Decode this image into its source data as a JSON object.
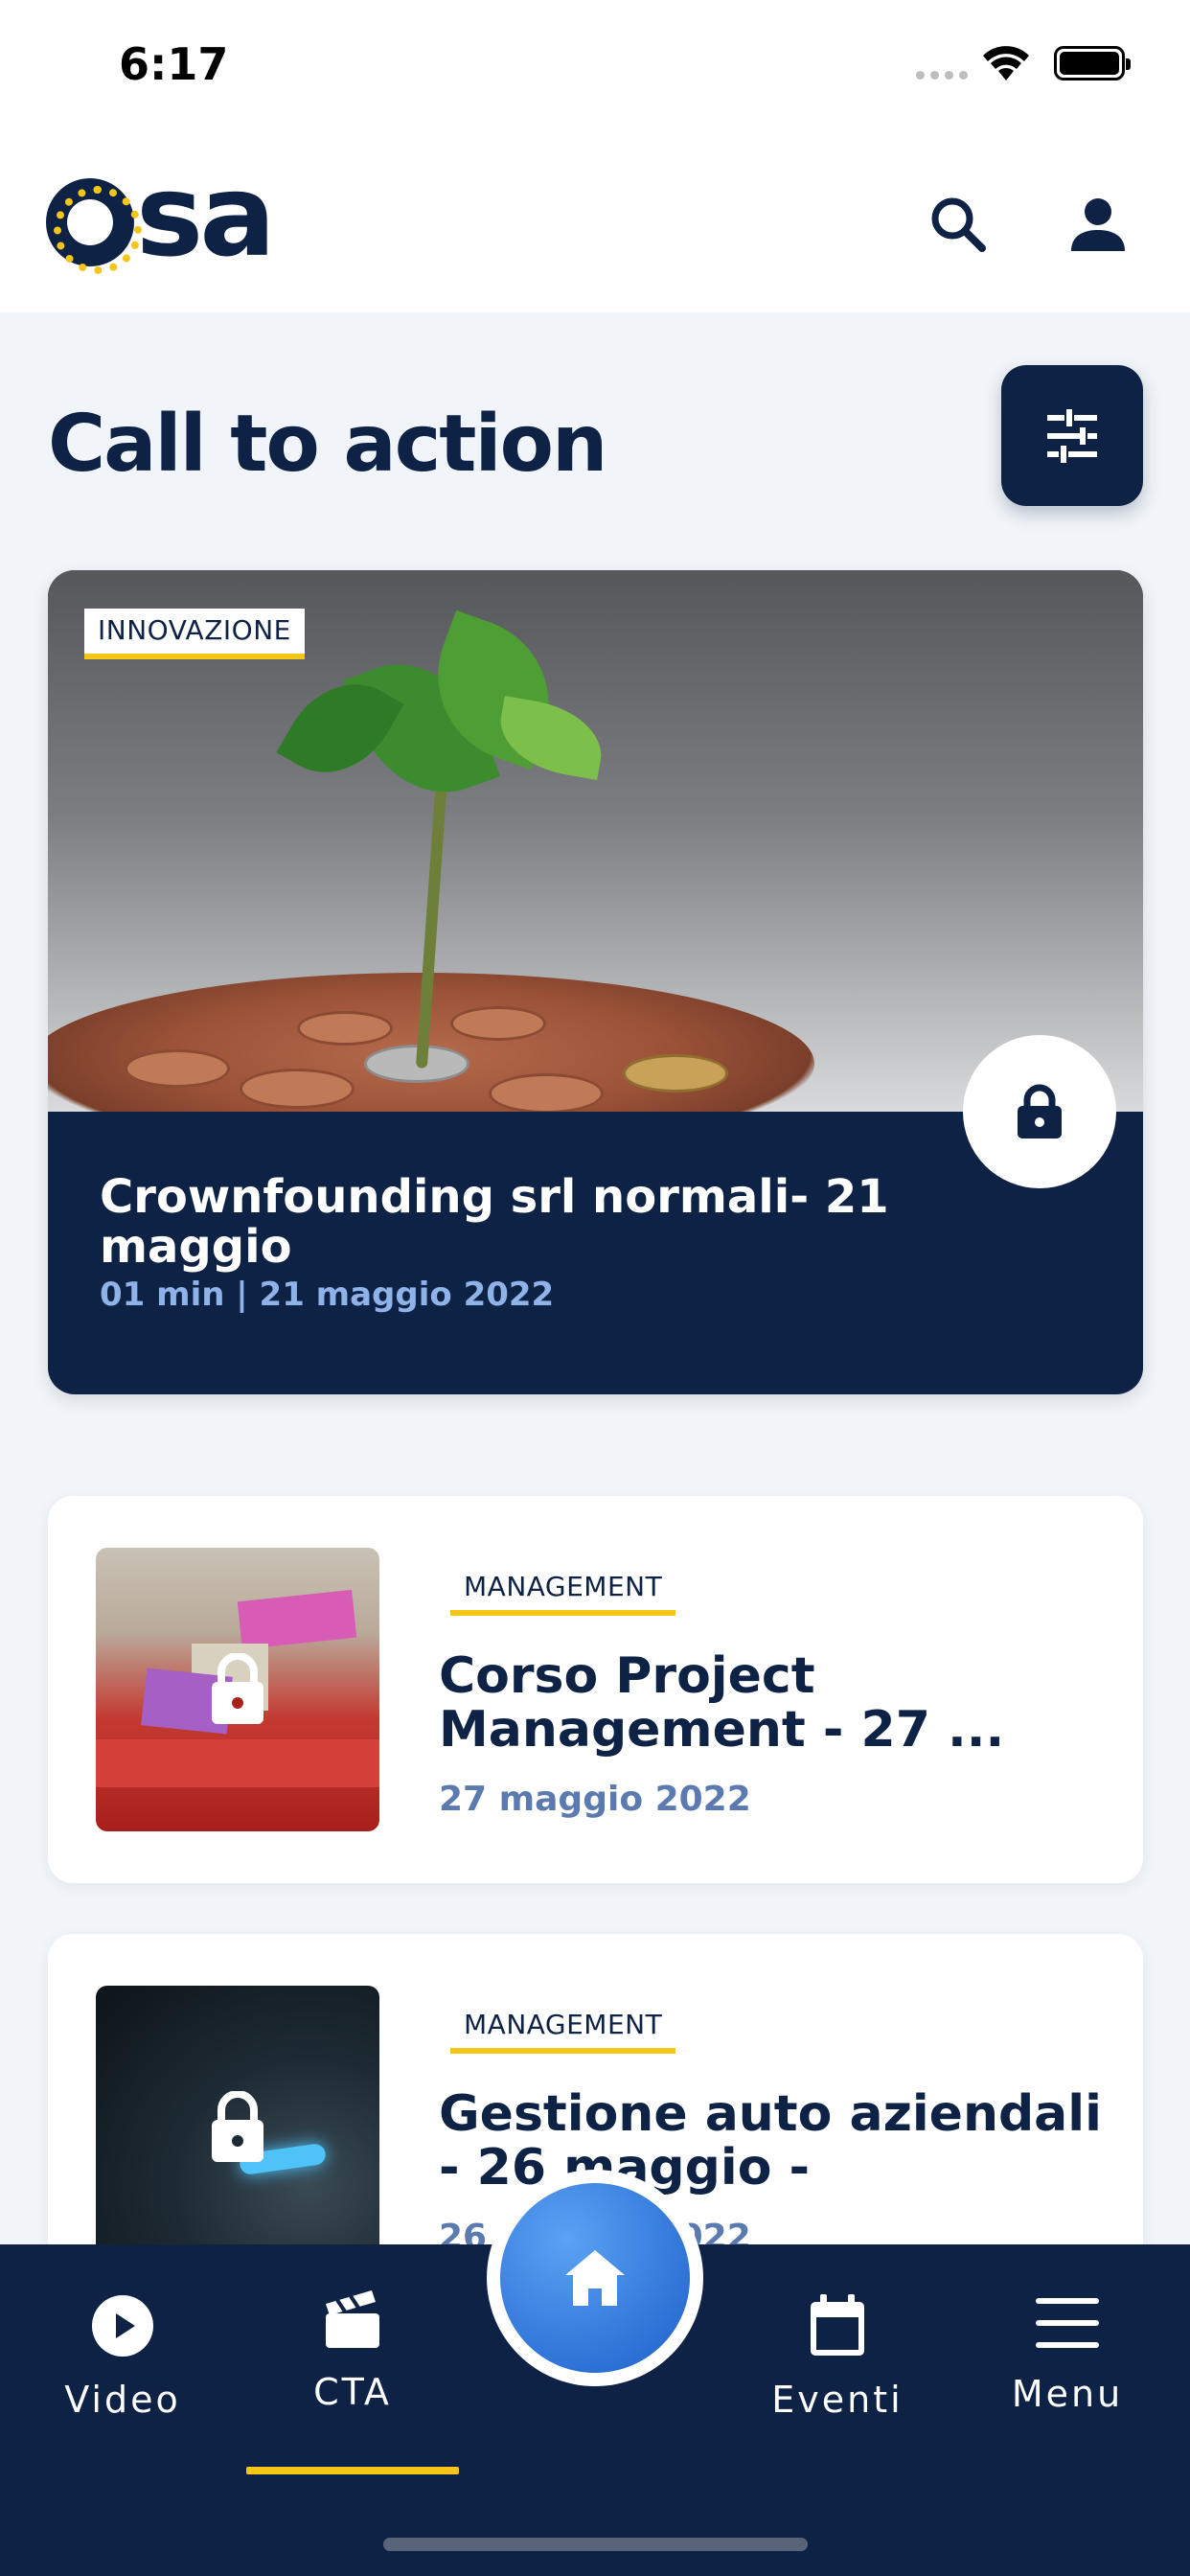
{
  "status_bar": {
    "time": "6:17"
  },
  "header": {
    "logo_text": "sa",
    "search_icon": "search-icon",
    "profile_icon": "user-icon"
  },
  "page": {
    "title": "Call to action",
    "filter_icon": "sliders-icon"
  },
  "featured": {
    "tag": "INNOVAZIONE",
    "title": "Crownfounding srl normali- 21 maggio",
    "meta": "01 min  |  21 maggio 2022",
    "locked": true
  },
  "cards": [
    {
      "tag": "MANAGEMENT",
      "title": "Corso Project Management - 27 ...",
      "date": "27 maggio 2022",
      "locked": true
    },
    {
      "tag": "MANAGEMENT",
      "title": "Gestione auto aziendali - 26 maggio -",
      "date": "26 maggio 2022",
      "locked": true
    }
  ],
  "bottom_nav": {
    "items": [
      {
        "label": "Video",
        "icon": "play-icon"
      },
      {
        "label": "CTA",
        "icon": "clapperboard-icon"
      },
      {
        "label": "Eventi",
        "icon": "calendar-icon"
      },
      {
        "label": "Menu",
        "icon": "menu-icon"
      }
    ],
    "home_icon": "home-icon",
    "active": "CTA"
  },
  "colors": {
    "navy": "#0E2245",
    "accent_yellow": "#F5C518",
    "home_blue": "#2F73D6",
    "meta_blue": "#8FB2E8"
  }
}
